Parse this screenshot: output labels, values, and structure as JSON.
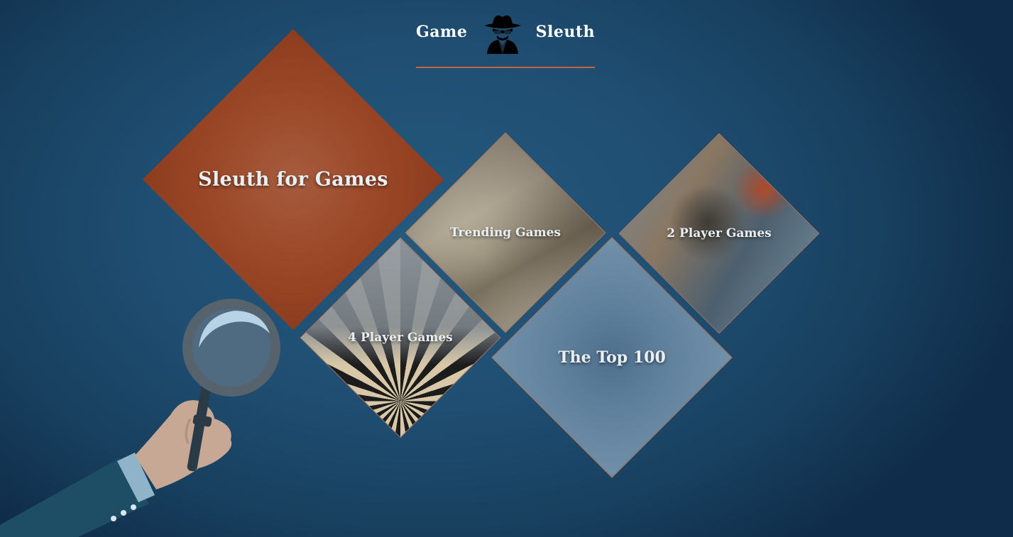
{
  "header": {
    "brand_left": "Game",
    "brand_right": "Sleuth",
    "logo_icon": "spy-icon",
    "underline_color": "#c2643d"
  },
  "tiles": {
    "sleuth": {
      "label": "Sleuth for Games",
      "color": "#9a4827"
    },
    "trending": {
      "label": "Trending Games"
    },
    "two_player": {
      "label": "2 Player Games"
    },
    "four_player": {
      "label": "4 Player Games"
    },
    "top100": {
      "label": "The Top 100",
      "color": "#6a89a4"
    }
  },
  "illustration": {
    "icon": "magnifying-glass-hand-icon"
  },
  "colors": {
    "background": "#1f4e72",
    "accent": "#c2643d"
  }
}
